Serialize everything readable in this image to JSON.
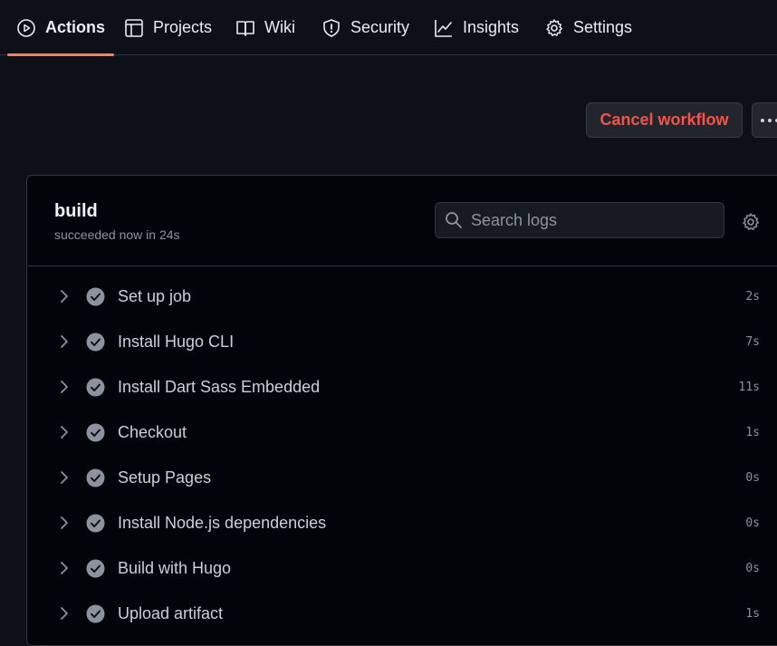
{
  "nav": {
    "tabs": [
      {
        "label": "Actions",
        "icon": "play-circle-icon",
        "active": true
      },
      {
        "label": "Projects",
        "icon": "table-icon",
        "active": false
      },
      {
        "label": "Wiki",
        "icon": "book-icon",
        "active": false
      },
      {
        "label": "Security",
        "icon": "shield-icon",
        "active": false
      },
      {
        "label": "Insights",
        "icon": "graph-icon",
        "active": false
      },
      {
        "label": "Settings",
        "icon": "gear-icon",
        "active": false
      }
    ]
  },
  "actions": {
    "cancel_label": "Cancel workflow",
    "more_icon": "kebab-horizontal-icon"
  },
  "job": {
    "title": "build",
    "status": "succeeded now in 24s",
    "search_placeholder": "Search logs",
    "settings_icon": "gear-icon"
  },
  "steps": [
    {
      "name": "Set up job",
      "duration": "2s"
    },
    {
      "name": "Install Hugo CLI",
      "duration": "7s"
    },
    {
      "name": "Install Dart Sass Embedded",
      "duration": "11s"
    },
    {
      "name": "Checkout",
      "duration": "1s"
    },
    {
      "name": "Setup Pages",
      "duration": "0s"
    },
    {
      "name": "Install Node.js dependencies",
      "duration": "0s"
    },
    {
      "name": "Build with Hugo",
      "duration": "0s"
    },
    {
      "name": "Upload artifact",
      "duration": "1s"
    }
  ],
  "colors": {
    "background": "#0d1117",
    "accent": "#f78166",
    "danger": "#f85149",
    "success_muted": "#8b949e"
  }
}
